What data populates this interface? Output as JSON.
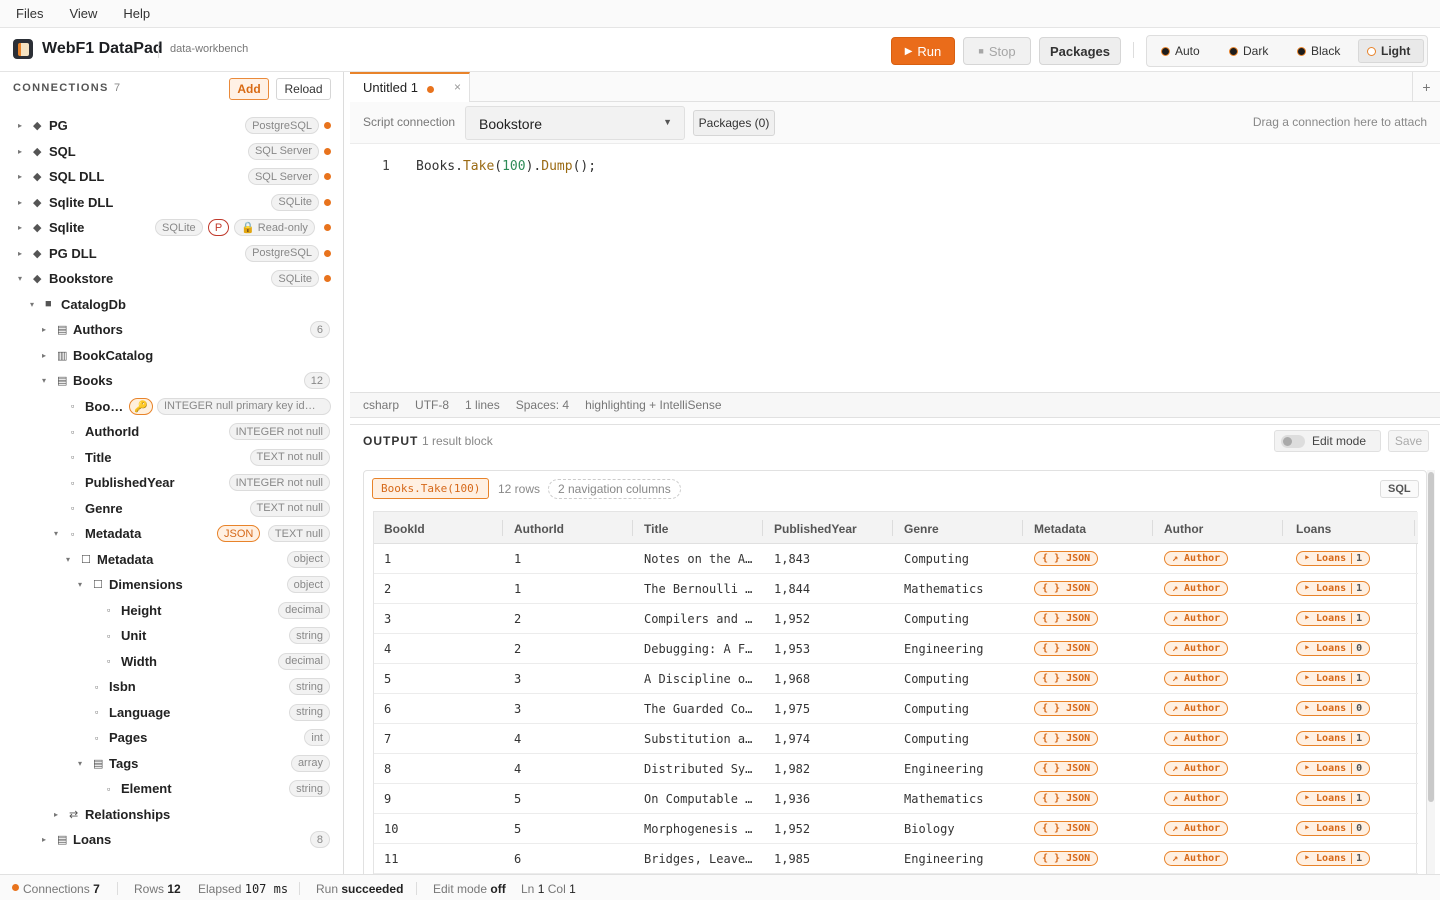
{
  "menu": {
    "files": "Files",
    "view": "View",
    "help": "Help"
  },
  "app": {
    "title": "WebF1 DataPad",
    "subtitle": "data-workbench"
  },
  "header": {
    "run": "Run",
    "stop": "Stop",
    "packages": "Packages",
    "themes": [
      {
        "label": "Auto"
      },
      {
        "label": "Dark"
      },
      {
        "label": "Black"
      },
      {
        "label": "Light",
        "active": true
      }
    ]
  },
  "sidebar": {
    "heading": "CONNECTIONS",
    "count": "7",
    "add": "Add",
    "reload": "Reload",
    "connections": [
      {
        "name": "PG",
        "type": "PostgreSQL"
      },
      {
        "name": "SQL",
        "type": "SQL Server"
      },
      {
        "name": "SQL DLL",
        "type": "SQL Server"
      },
      {
        "name": "Sqlite DLL",
        "type": "SQLite"
      },
      {
        "name": "Sqlite",
        "type": "SQLite",
        "badge": "P",
        "readonly": "🔒 Read-only"
      },
      {
        "name": "PG DLL",
        "type": "PostgreSQL"
      },
      {
        "name": "Bookstore",
        "type": "SQLite"
      }
    ],
    "catalog": "CatalogDb",
    "tables": {
      "authors": {
        "name": "Authors",
        "count": "6"
      },
      "bookcatalog": {
        "name": "BookCatalog"
      },
      "books": {
        "name": "Books",
        "count": "12"
      },
      "loans": {
        "name": "Loans",
        "count": "8"
      }
    },
    "columns": [
      {
        "name": "Boo…",
        "type": "INTEGER null primary key id…"
      },
      {
        "name": "AuthorId",
        "type": "INTEGER not null"
      },
      {
        "name": "Title",
        "type": "TEXT not null"
      },
      {
        "name": "PublishedYear",
        "type": "INTEGER not null"
      },
      {
        "name": "Genre",
        "type": "TEXT not null"
      }
    ],
    "metadata": {
      "name": "Metadata",
      "json": "JSON",
      "type": "TEXT null"
    },
    "nested": [
      {
        "name": "Metadata",
        "type": "object"
      },
      {
        "name": "Dimensions",
        "type": "object"
      },
      {
        "name": "Height",
        "type": "decimal"
      },
      {
        "name": "Unit",
        "type": "string"
      },
      {
        "name": "Width",
        "type": "decimal"
      },
      {
        "name": "Isbn",
        "type": "string"
      },
      {
        "name": "Language",
        "type": "string"
      },
      {
        "name": "Pages",
        "type": "int"
      },
      {
        "name": "Tags",
        "type": "array"
      },
      {
        "name": "Element",
        "type": "string"
      }
    ],
    "relationships": "Relationships"
  },
  "tab": {
    "title": "Untitled 1",
    "close": "×",
    "plus": "+"
  },
  "toolbar": {
    "script_connection": "Script connection",
    "selected": "Bookstore",
    "packages": "Packages (0)",
    "drag_hint": "Drag a connection here to attach"
  },
  "editor": {
    "line_number": "1",
    "code": {
      "ident": "Books",
      "dot1": ".",
      "take": "Take",
      "open": "(",
      "num": "100",
      "close": ")",
      "dot2": ".",
      "dump": "Dump",
      "tail": "();"
    }
  },
  "editor_status": [
    "csharp",
    "UTF-8",
    "1 lines",
    "Spaces: 4",
    "highlighting + IntelliSense"
  ],
  "output": {
    "label": "OUTPUT",
    "blocks": "1 result block",
    "edit_mode": "Edit mode",
    "save": "Save",
    "query": "Books.Take(100)",
    "rows": "12 rows",
    "nav": "2 navigation columns",
    "sql": "SQL",
    "columns": [
      "BookId",
      "AuthorId",
      "Title",
      "PublishedYear",
      "Genre",
      "Metadata",
      "Author",
      "Loans"
    ],
    "json_label": "{ } JSON",
    "author_label": "↗ Author",
    "loans_label": "‣ Loans",
    "rows_data": [
      [
        "1",
        "1",
        "Notes on the A…",
        "1,843",
        "Computing",
        "1"
      ],
      [
        "2",
        "1",
        "The Bernoulli …",
        "1,844",
        "Mathematics",
        "1"
      ],
      [
        "3",
        "2",
        "Compilers and …",
        "1,952",
        "Computing",
        "1"
      ],
      [
        "4",
        "2",
        "Debugging: A F…",
        "1,953",
        "Engineering",
        "0"
      ],
      [
        "5",
        "3",
        "A Discipline o…",
        "1,968",
        "Computing",
        "1"
      ],
      [
        "6",
        "3",
        "The Guarded Co…",
        "1,975",
        "Computing",
        "0"
      ],
      [
        "7",
        "4",
        "Substitution a…",
        "1,974",
        "Computing",
        "1"
      ],
      [
        "8",
        "4",
        "Distributed Sy…",
        "1,982",
        "Engineering",
        "0"
      ],
      [
        "9",
        "5",
        "On Computable …",
        "1,936",
        "Mathematics",
        "1"
      ],
      [
        "10",
        "5",
        "Morphogenesis …",
        "1,952",
        "Biology",
        "0"
      ],
      [
        "11",
        "6",
        "Bridges, Leave…",
        "1,985",
        "Engineering",
        "1"
      ]
    ]
  },
  "footer": {
    "connections_label": "Connections",
    "connections": "7",
    "rows_label": "Rows",
    "rows": "12",
    "elapsed_label": "Elapsed",
    "elapsed": "107 ms",
    "run_label": "Run",
    "run": "succeeded",
    "edit_label": "Edit mode",
    "edit": "off",
    "ln_label": "Ln",
    "ln": "1",
    "col_label": "Col",
    "col": "1"
  },
  "colors": {
    "accent": "#e8731d",
    "panel": "#fafafa"
  }
}
